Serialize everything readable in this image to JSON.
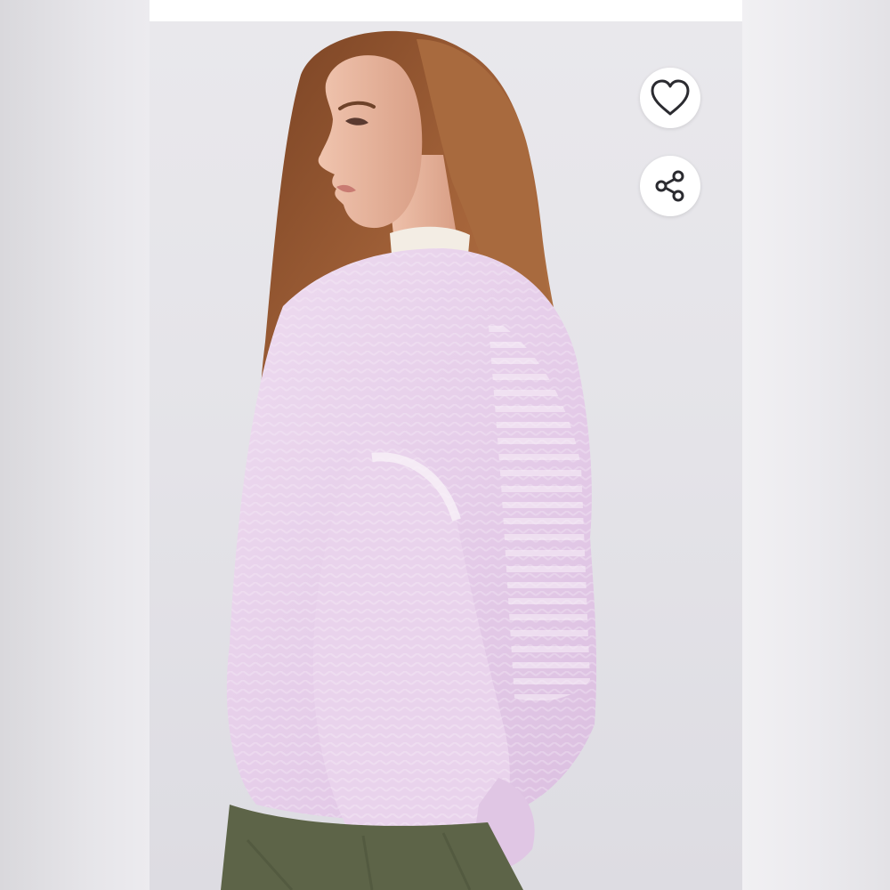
{
  "screen": {
    "type": "product-photo-viewer"
  },
  "image": {
    "alt": "",
    "colors": {
      "background": "#e8e7eb",
      "sweater": "#e6cfe9",
      "hair": "#9a5a30",
      "skin": "#e7b9a3",
      "pants": "#5d6448"
    }
  },
  "actions": {
    "like_icon": "heart-outline",
    "share_icon": "share-nodes"
  }
}
